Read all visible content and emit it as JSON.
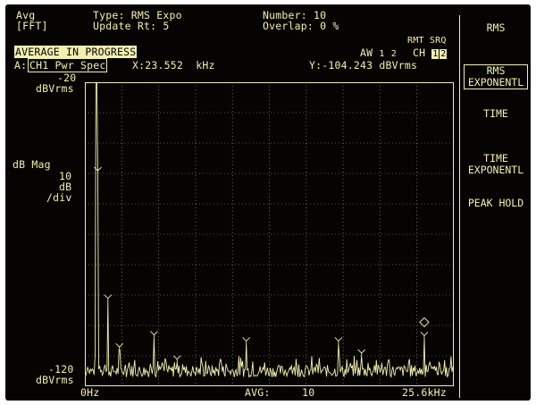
{
  "header": {
    "avg_label": "Avg",
    "fft_label": "[FFT]",
    "type_line": "Type: RMS Expo",
    "update_line": "Update Rt: 5",
    "number_line": "Number: 10",
    "overlap_line": "Overlap: 0 %"
  },
  "status": {
    "average_in_progress": "AVERAGE IN PROGRESS",
    "rmt_srq": "RMT SRQ",
    "aw_label": "AW",
    "aw_1": "1",
    "aw_2": "2",
    "ch_label": "CH",
    "ch_1": "1",
    "ch_2": "2"
  },
  "trace": {
    "trace_label": "A:",
    "trace_name": "CH1 Pwr Spec",
    "x_readout": "X:23.552  kHz",
    "y_readout": "Y:-104.243 dBVrms"
  },
  "axis": {
    "y_top_value": "-20",
    "y_top_unit": "dBVrms",
    "y_label": "dB Mag",
    "y_scale_1": "10",
    "y_scale_2": "dB",
    "y_scale_3": "/div",
    "y_bottom_value": "-120",
    "y_bottom_unit": "dBVrms",
    "x_start": "0Hz",
    "avg_readout": "AVG:     10",
    "x_end": "25.6kHz"
  },
  "softkeys": [
    {
      "label": "RMS",
      "active": false
    },
    {
      "label": "RMS\nEXPONENTL",
      "active": true
    },
    {
      "label": "TIME",
      "active": false
    },
    {
      "label": "TIME\nEXPONENTL",
      "active": false
    },
    {
      "label": "PEAK HOLD",
      "active": false
    }
  ],
  "chart_data": {
    "type": "line",
    "xlim": [
      0,
      25.6
    ],
    "ylim": [
      -120,
      -20
    ],
    "grid": true,
    "peaks": [
      {
        "x": 0.8,
        "y": -20
      },
      {
        "x": 0.9,
        "y": -50
      },
      {
        "x": 1.6,
        "y": -92
      },
      {
        "x": 2.4,
        "y": -108
      },
      {
        "x": 4.8,
        "y": -104
      },
      {
        "x": 6.4,
        "y": -112
      },
      {
        "x": 11.2,
        "y": -106
      },
      {
        "x": 17.6,
        "y": -106
      },
      {
        "x": 19.2,
        "y": -110
      },
      {
        "x": 23.552,
        "y": -104.243
      }
    ],
    "marker": {
      "x": 23.552,
      "y": -104.243
    }
  }
}
